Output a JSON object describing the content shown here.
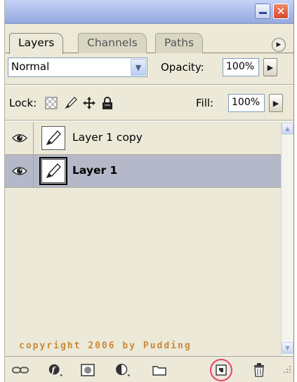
{
  "panel": {
    "tabs": [
      {
        "label": "Layers",
        "active": true
      },
      {
        "label": "Channels",
        "active": false
      },
      {
        "label": "Paths",
        "active": false
      }
    ],
    "blend_mode": "Normal",
    "opacity_label": "Opacity:",
    "opacity_value": "100%",
    "lock_label": "Lock:",
    "fill_label": "Fill:",
    "fill_value": "100%"
  },
  "layers": [
    {
      "name": "Layer 1 copy",
      "selected": false,
      "visible": true
    },
    {
      "name": "Layer 1",
      "selected": true,
      "visible": true
    }
  ],
  "watermark": "copyright 2006 by Pudding",
  "icons": {
    "titlebar": [
      "minimize-icon",
      "close-icon"
    ],
    "lock": [
      "lock-transparent-pixels-icon",
      "lock-image-pixels-icon",
      "lock-position-icon",
      "lock-all-icon"
    ],
    "bottom": [
      "link-layers-icon",
      "layer-style-icon",
      "layer-mask-icon",
      "adjustment-layer-icon",
      "new-group-icon",
      "new-layer-icon",
      "delete-layer-icon"
    ]
  },
  "colors": {
    "panel_bg": "#ece9d8",
    "selected_row": "#b5b8c8",
    "title_bar": "#a9bbea",
    "watermark": "#c98a3a",
    "highlight_ring": "#e6417a"
  }
}
